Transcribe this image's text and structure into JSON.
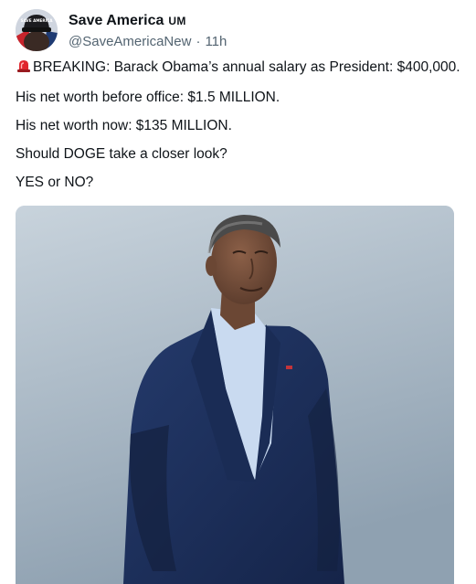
{
  "author": {
    "display_name": "Save America",
    "badge": "UM",
    "handle": "@SaveAmericaNew",
    "separator": "·",
    "time": "11h",
    "avatar_icon": "avatar-hat-icon",
    "avatar_hat_text": "SAVE AMERICA"
  },
  "post": {
    "lines": [
      "BREAKING: Barack Obama’s annual salary as President: $400,000.",
      "His net worth before office: $1.5 MILLION.",
      "His net worth now: $135 MILLION.",
      "Should DOGE take a closer look?",
      "YES or NO?"
    ],
    "lead_icon": "siren-icon"
  },
  "media": {
    "icon": "portrait-photo",
    "colors": {
      "background_top": "#c8d3dc",
      "background_bottom": "#8fa1b1",
      "suit": "#1d2f5a",
      "shirt": "#c9daf0",
      "skin": "#7a5340"
    }
  },
  "colors": {
    "text": "#0f1419",
    "secondary_text": "#536471",
    "siren_red": "#e0242c"
  }
}
